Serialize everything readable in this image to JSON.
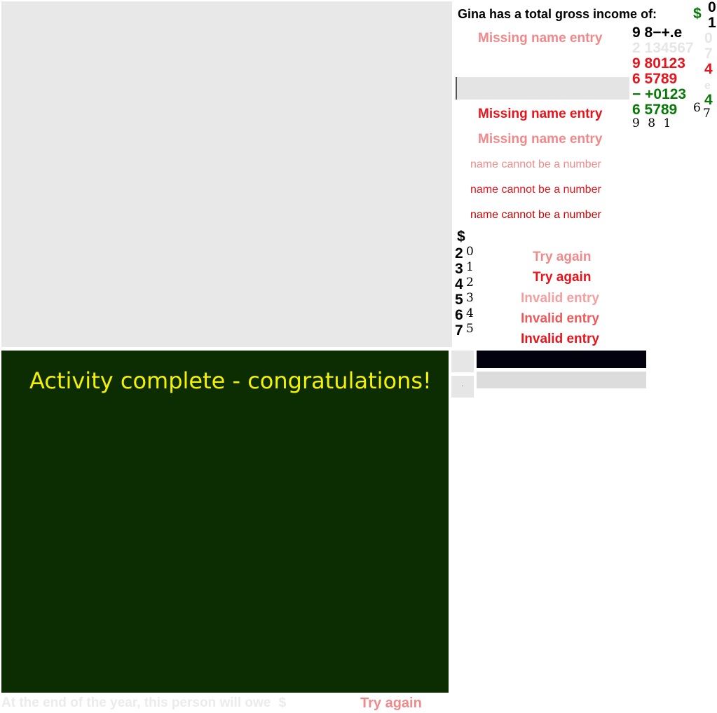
{
  "activity": {
    "complete_message": "Activity complete - congratulations!"
  },
  "question": {
    "text": "Gina has a total gross income of:",
    "currency": "$"
  },
  "errors": {
    "missing_name": [
      "Missing name entry",
      "Missing name entry",
      "Missing name entry"
    ],
    "name_number": [
      "name cannot be a number",
      "name cannot be a number",
      "name cannot be a number"
    ],
    "try_again": [
      "Try again",
      "Try again"
    ],
    "invalid_entry": [
      "Invalid entry",
      "Invalid entry",
      "Invalid entry"
    ]
  },
  "keypad": {
    "top_row": "9 8−+.e",
    "grey_row": "2 134567",
    "red_row1": "9 80123",
    "red_row2": "6 5789",
    "green_row1": "− +0123",
    "green_row2": "6 5789",
    "green_extra_top": "4",
    "red_extra": "4",
    "right_col_digits": [
      "0",
      "1"
    ],
    "grey_col": [
      "0",
      "7"
    ],
    "serif_67": "6",
    "serif_7": "7",
    "serif_981": "9 8 1",
    "faint_dot": ".",
    "faint_e": "e"
  },
  "amount_column": {
    "currency": "$",
    "bold_digits": [
      "2",
      "3",
      "4",
      "5",
      "6",
      "7"
    ],
    "serif_digits": [
      "0",
      "1",
      "2",
      "3",
      "4",
      "5"
    ]
  },
  "small_button_label": ".",
  "bottom": {
    "question": "At the end of the year, this person will owe",
    "currency": "$",
    "try_again": "Try again"
  },
  "colors": {
    "done_panel": "#0c2c02",
    "done_text": "#f4f000",
    "error_red": "#e8141c",
    "error_pink": "#f08a8a",
    "success_green": "#077a07"
  }
}
